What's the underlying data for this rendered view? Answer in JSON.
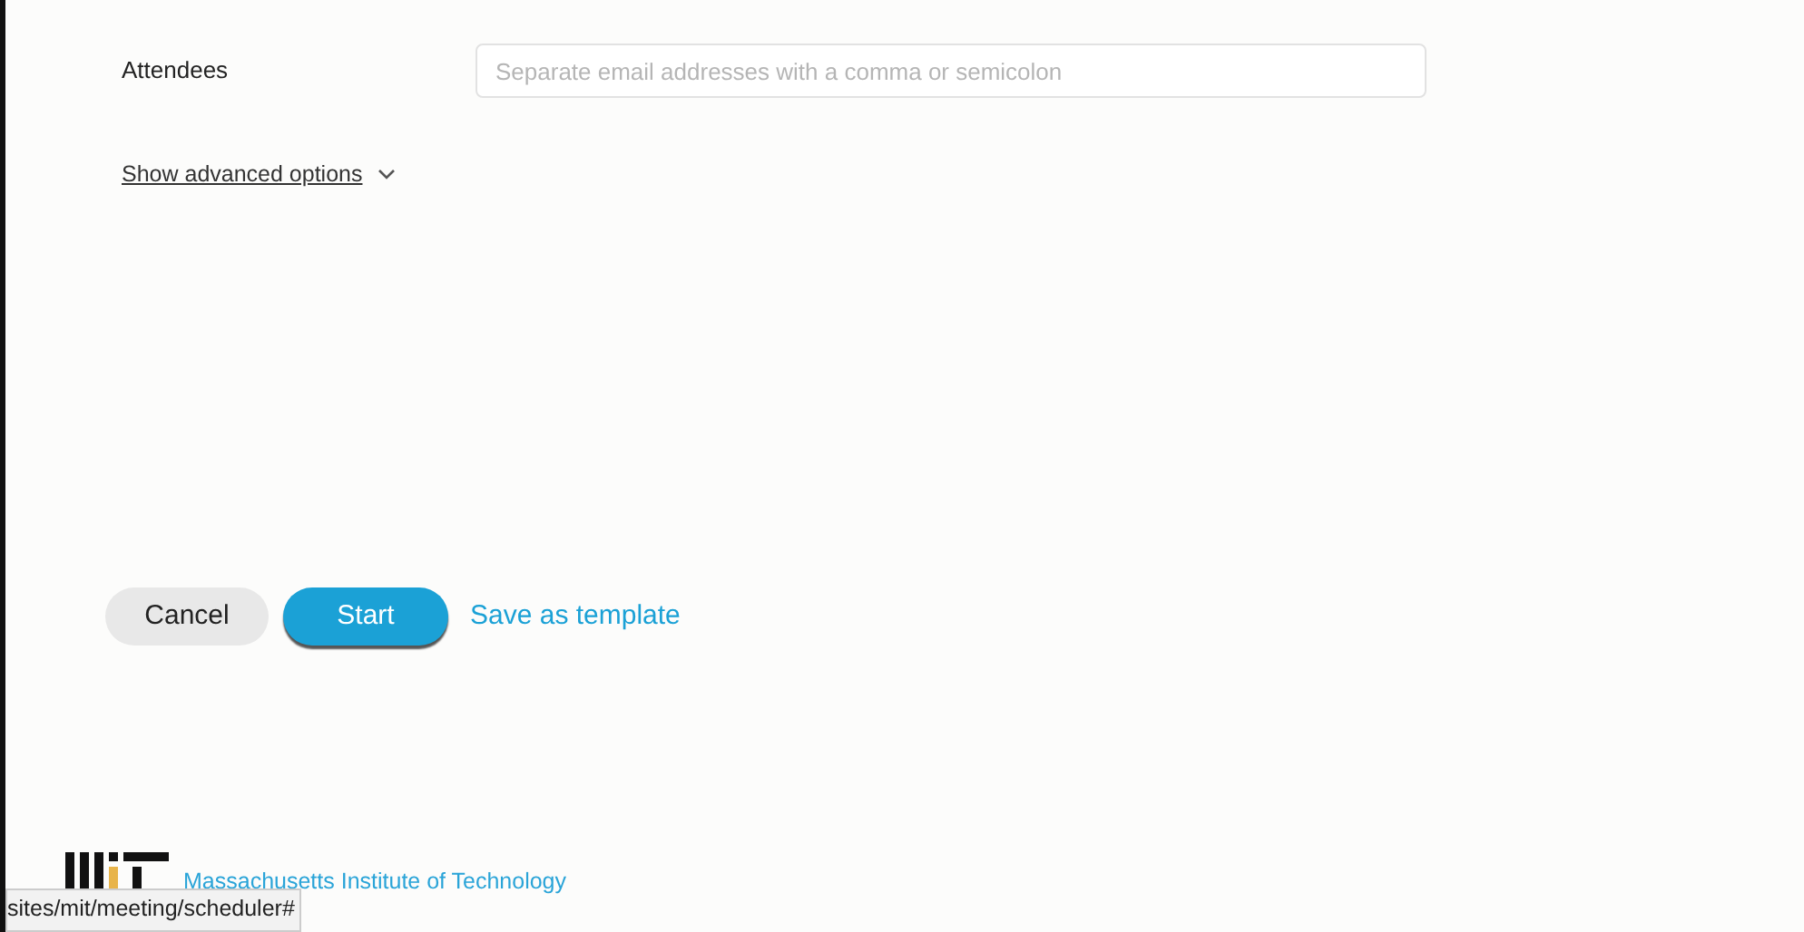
{
  "attendees": {
    "label": "Attendees",
    "placeholder": "Separate email addresses with a comma or semicolon"
  },
  "advanced_link": {
    "label": "Show advanced options",
    "expanded": false
  },
  "buttons": [
    {
      "kind": "secondary",
      "label": "Cancel"
    },
    {
      "kind": "primary",
      "label": "Start"
    },
    {
      "kind": "link",
      "label": "Save as template"
    }
  ],
  "footer": {
    "org": "Massachusetts Institute of Technology"
  },
  "status_url": "sites/mit/meeting/scheduler#"
}
